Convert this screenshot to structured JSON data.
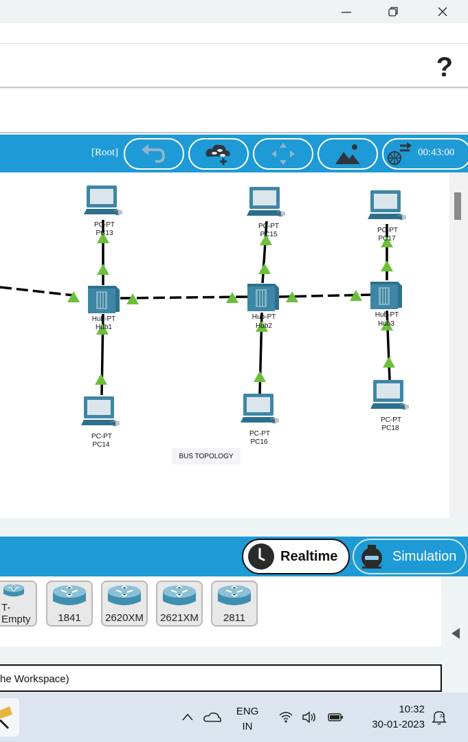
{
  "window": {
    "minimize_icon": "minimize-icon",
    "restore_icon": "restore-icon",
    "close_icon": "close-icon"
  },
  "toolbar": {
    "help_label": "?"
  },
  "workspace_bar": {
    "root_label": "[Root]",
    "clock": "00:43:00",
    "buttons": [
      "back-arrow-icon",
      "cluster-add-icon",
      "move-arrows-icon",
      "background-image-icon",
      "viewport-globe-icon"
    ]
  },
  "topology": {
    "note": "BUS TOPOLOGY",
    "hubs": [
      {
        "type": "Hub-PT",
        "name": "Hub1"
      },
      {
        "type": "Hub-PT",
        "name": "Hub2"
      },
      {
        "type": "Hub-PT",
        "name": "Hub3"
      }
    ],
    "pcs": [
      {
        "type": "PC-PT",
        "name": "PC13"
      },
      {
        "type": "PC-PT",
        "name": "PC14"
      },
      {
        "type": "PC-PT",
        "name": "PC15"
      },
      {
        "type": "PC-PT",
        "name": "PC16"
      },
      {
        "type": "PC-PT",
        "name": "PC17"
      },
      {
        "type": "PC-PT",
        "name": "PC18"
      }
    ],
    "link_status_color": "#6bbf3b"
  },
  "modes": {
    "realtime_label": "Realtime",
    "simulation_label": "Simulation"
  },
  "devices": [
    {
      "label": "T-Empty"
    },
    {
      "label": "1841"
    },
    {
      "label": "2620XM"
    },
    {
      "label": "2621XM"
    },
    {
      "label": "2811"
    }
  ],
  "info": {
    "text": "he Workspace)"
  },
  "taskbar": {
    "lang_top": "ENG",
    "lang_bottom": "IN",
    "time": "10:32",
    "date": "30-01-2023"
  },
  "colors": {
    "accent": "#1e9ad6",
    "link_green": "#6bbf3b"
  }
}
